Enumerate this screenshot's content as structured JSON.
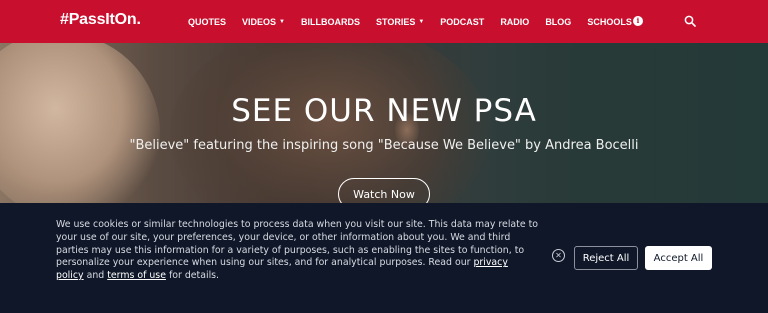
{
  "header": {
    "logo": "#PassItOn.",
    "nav": [
      {
        "label": "QUOTES",
        "caret": ""
      },
      {
        "label": "VIDEOS",
        "caret": "▼"
      },
      {
        "label": "BILLBOARDS",
        "caret": ""
      },
      {
        "label": "STORIES",
        "caret": "▼"
      },
      {
        "label": "PODCAST",
        "caret": ""
      },
      {
        "label": "RADIO",
        "caret": ""
      },
      {
        "label": "BLOG",
        "caret": ""
      },
      {
        "label": "SCHOOLS",
        "caret": "▼"
      }
    ],
    "info_glyph": "i",
    "icons": {
      "info": "info-icon",
      "search": "search-icon"
    }
  },
  "hero": {
    "title": "SEE OUR NEW PSA",
    "subtitle": "\"Believe\" featuring the inspiring song \"Because We Believe\" by Andrea Bocelli",
    "button_label": "Watch Now"
  },
  "cookie_banner": {
    "text_before": "We use cookies or similar technologies to process data when you visit our site. This data may relate to your use of our site, your preferences, your device, or other information about you. We and third parties may use this information for a variety of purposes, such as enabling the sites to function, to personalize your experience when using our sites, and for analytical purposes. Read our ",
    "privacy_link": "privacy policy",
    "text_and": " and ",
    "terms_link": "terms of use",
    "text_after": " for details.",
    "close_glyph": "✕",
    "reject_label": "Reject All",
    "accept_label": "Accept All"
  },
  "colors": {
    "brand_red": "#c8102e",
    "banner_bg": "#0f1728"
  }
}
